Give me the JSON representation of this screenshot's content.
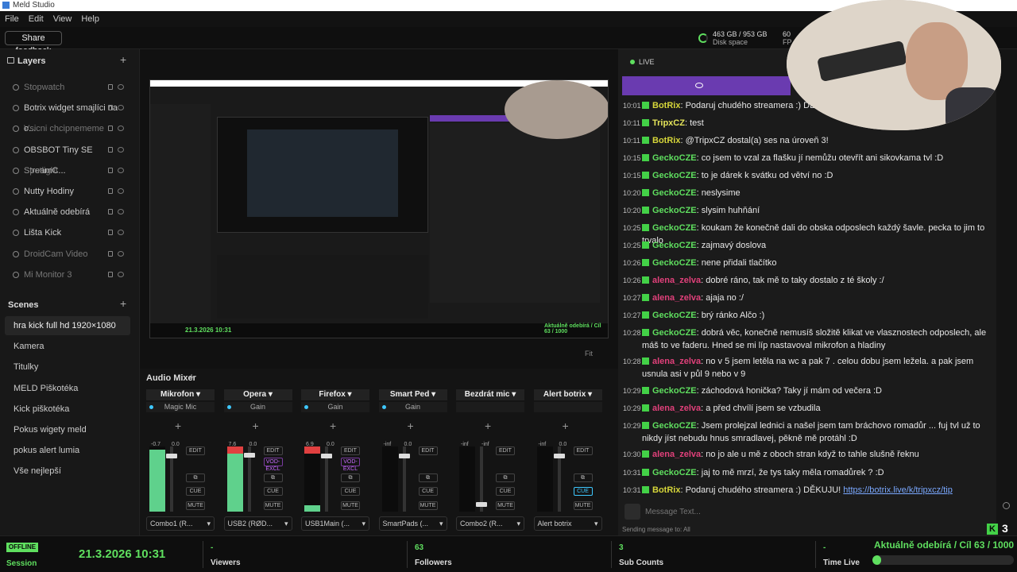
{
  "window": {
    "title": "Meld Studio"
  },
  "menu": [
    "File",
    "Edit",
    "View",
    "Help"
  ],
  "toolbar": {
    "feedback_label": "Share feedback",
    "disk_value": "463 GB / 953 GB",
    "disk_label": "Disk space",
    "fps_value": "60",
    "fps_label": "FP"
  },
  "layers": {
    "title": "Layers",
    "items": [
      "Stopwatch",
      "Botrix widget smajlíci na o...",
      "Vsicni chcipnememe",
      "OBSBOT Tiny SE StreamC...",
      "Spotlight",
      "Nutty Hodiny",
      "Aktuálně odebírá",
      "Lišta Kick",
      "DroidCam Video",
      "Mi Monitor 3"
    ]
  },
  "scenes": {
    "title": "Scenes",
    "items": [
      "hra kick full hd 1920×1080",
      "Kamera",
      "Titulky",
      "MELD Piškotéka",
      "Kick piškotéka",
      "Pokus wigety meld",
      "pokus alert lumia",
      "Vše nejlepší"
    ]
  },
  "preview": {
    "fit_label": "Fit"
  },
  "mixer": {
    "title": "Audio Mixer",
    "channels": [
      {
        "name": "Mikrofon",
        "fx": "Magic Mic",
        "level": "-0.7",
        "db": "0.0",
        "device": "Combo1 (R...",
        "meter": 0.95,
        "fader": 0.88
      },
      {
        "name": "Opera",
        "fx": "Gain",
        "level": "7.6",
        "db": "0.0",
        "device": "USB2 (RØD...",
        "meter": 1.0,
        "fader": 0.9
      },
      {
        "name": "Firefox",
        "fx": "Gain",
        "level": "6.9",
        "db": "0.0",
        "device": "USB1Main (...",
        "meter": 0.1,
        "fader": 0.88
      },
      {
        "name": "Smart Ped",
        "fx": "Gain",
        "level": "-inf",
        "db": "0.0",
        "device": "SmartPads (...",
        "meter": 0.0,
        "fader": 0.88
      },
      {
        "name": "Bezdrát mic",
        "fx": "",
        "level": "-inf",
        "db": "-inf",
        "device": "Combo2 (R...",
        "meter": 0.0,
        "fader": 0.08
      },
      {
        "name": "Alert botrix",
        "fx": "",
        "level": "-inf",
        "db": "0.0",
        "device": "Alert botrix",
        "meter": 0.0,
        "fader": 0.88
      }
    ],
    "edit": "EDIT",
    "cue": "CUE",
    "mute": "MUTE",
    "vod": "VOD-EXCL"
  },
  "chat": {
    "live": "LIVE",
    "send_placeholder": "Message Text...",
    "sending_to": "Sending message to: All",
    "messages": [
      {
        "t": "10:01",
        "u": "BotRix",
        "c": "#d6d63a",
        "m": ": Podaruj chudého streamera :) DĚKU"
      },
      {
        "t": "10:11",
        "u": "TripxCZ",
        "c": "#e4e45a",
        "m": ": test"
      },
      {
        "t": "10:11",
        "u": "BotRix",
        "c": "#d6d63a",
        "m": ": @TripxCZ dostal(a) ses na úroveň 3!"
      },
      {
        "t": "10:15",
        "u": "GeckoCZE",
        "c": "#5fdf5f",
        "m": ": co jsem to vzal za flašku jí nemůžu otevřít ani sikovkama tvl :D"
      },
      {
        "t": "10:15",
        "u": "GeckoCZE",
        "c": "#5fdf5f",
        "m": ": to je dárek k svátku od větví no :D"
      },
      {
        "t": "10:20",
        "u": "GeckoCZE",
        "c": "#5fdf5f",
        "m": ": neslysime"
      },
      {
        "t": "10:20",
        "u": "GeckoCZE",
        "c": "#5fdf5f",
        "m": ": slysim huhňání"
      },
      {
        "t": "10:25",
        "u": "GeckoCZE",
        "c": "#5fdf5f",
        "m": ": koukam že konečně dali do obska odposlech každý šavle. pecka to jim to trvalo"
      },
      {
        "t": "10:25",
        "u": "GeckoCZE",
        "c": "#5fdf5f",
        "m": ": zajmavý doslova"
      },
      {
        "t": "10:26",
        "u": "GeckoCZE",
        "c": "#5fdf5f",
        "m": ": nene přidali tlačítko"
      },
      {
        "t": "10:26",
        "u": "alena_zelva",
        "c": "#e0407a",
        "m": ": dobré ráno, tak mě to taky dostalo z té školy :/"
      },
      {
        "t": "10:27",
        "u": "alena_zelva",
        "c": "#e0407a",
        "m": ": ajaja no :/"
      },
      {
        "t": "10:27",
        "u": "GeckoCZE",
        "c": "#5fdf5f",
        "m": ": brý ránko Alčo :)"
      },
      {
        "t": "10:28",
        "u": "GeckoCZE",
        "c": "#5fdf5f",
        "m": ": dobrá věc, konečně nemusíš složitě klikat ve vlasznostech odposlech, ale máš to ve faderu. Hned se mi líp nastavoval mikrofon a hladiny"
      },
      {
        "t": "10:28",
        "u": "alena_zelva",
        "c": "#e0407a",
        "m": ": no v 5 jsem letěla na wc a pak 7 . celou dobu jsem ležela. a pak jsem usnula asi v půl 9 nebo v 9"
      },
      {
        "t": "10:29",
        "u": "GeckoCZE",
        "c": "#5fdf5f",
        "m": ": záchodová honička? Taky jí mám od večera :D"
      },
      {
        "t": "10:29",
        "u": "alena_zelva",
        "c": "#e0407a",
        "m": ": a před chvílí jsem se vzbudila"
      },
      {
        "t": "10:29",
        "u": "GeckoCZE",
        "c": "#5fdf5f",
        "m": ": Jsem prolejzal lednici a našel jsem tam bráchovo romadůr ... fuj tvl už to nikdy jíst nebudu hnus smradlavej, pěkně mě protáhl :D"
      },
      {
        "t": "10:30",
        "u": "alena_zelva",
        "c": "#e0407a",
        "m": ": no jo ale u mě z oboch stran když to tahle slušně řeknu"
      },
      {
        "t": "10:31",
        "u": "GeckoCZE",
        "c": "#5fdf5f",
        "m": ": jaj to mě mrzí, že tys taky měla romadůrek ? :D"
      },
      {
        "t": "10:31",
        "u": "BotRix",
        "c": "#d6d63a",
        "m": ": Podaruj chudého streamera :) DĚKUJU!",
        "link": "https://botrix.live/k/tripxcz/tip"
      }
    ]
  },
  "stats": {
    "offline": "OFFLINE",
    "session_value": "21.3.2026 10:31",
    "session_label": "Session",
    "viewers_value": "-",
    "viewers_label": "Viewers",
    "followers_value": "63",
    "followers_label": "Followers",
    "subs_value": "3",
    "subs_label": "Sub Counts",
    "time_value": "-",
    "time_label": "Time Live",
    "goal_text": "Aktuálně odebírá / Cíl  63 / 1000",
    "goal_fraction": 0.063,
    "kick_count": "3"
  }
}
